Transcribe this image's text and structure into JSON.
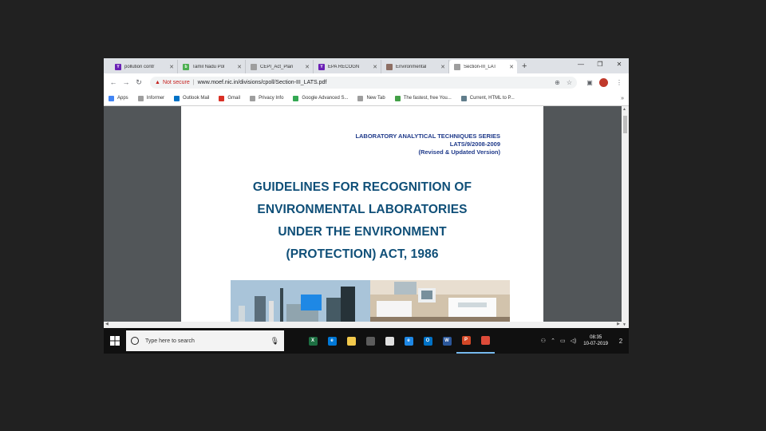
{
  "browser": {
    "tabs": [
      {
        "title": "pollution contr",
        "fav_letter": "Y",
        "fav_color": "#6a1fb5"
      },
      {
        "title": "Tamil Nadu Pol",
        "fav_letter": "b",
        "fav_color": "#4caf50"
      },
      {
        "title": "CEPI_Act_Plan",
        "fav_letter": "",
        "fav_color": "#9e9e9e"
      },
      {
        "title": "EPA RECOGN",
        "fav_letter": "Y",
        "fav_color": "#6a1fb5"
      },
      {
        "title": "Environmental",
        "fav_letter": "",
        "fav_color": "#8d6e63"
      },
      {
        "title": "Section-III_LAT",
        "fav_letter": "",
        "fav_color": "#9e9e9e"
      }
    ],
    "active_tab": 5,
    "security_label": "Not secure",
    "url": "www.moef.nic.in/divisions/cpoll/Section-III_LATS.pdf",
    "bookmarks": [
      {
        "label": "Apps",
        "color": "#4285f4"
      },
      {
        "label": "Informer",
        "color": "#9e9e9e"
      },
      {
        "label": "Outlook Mail",
        "color": "#0072c6"
      },
      {
        "label": "Gmail",
        "color": "#d93025"
      },
      {
        "label": "Privacy Info",
        "color": "#9e9e9e"
      },
      {
        "label": "Google Advanced S...",
        "color": "#34a853"
      },
      {
        "label": "New Tab",
        "color": "#9e9e9e"
      },
      {
        "label": "The fastest, free You...",
        "color": "#43a047"
      },
      {
        "label": "Current, HTML to P...",
        "color": "#607d8b"
      }
    ],
    "bookmarks_more": "»"
  },
  "document": {
    "series": [
      "LABORATORY ANALYTICAL TECHNIQUES SERIES",
      "LATS/9/2008-2009",
      "(Revised & Updated Version)"
    ],
    "title_lines": [
      "GUIDELINES FOR RECOGNITION OF",
      "ENVIRONMENTAL LABORATORIES",
      "UNDER THE ENVIRONMENT",
      "(PROTECTION) ACT, 1986"
    ]
  },
  "taskbar": {
    "search_placeholder": "Type here to search",
    "apps": [
      {
        "name": "task-view",
        "letter": "",
        "color": "#101010"
      },
      {
        "name": "excel",
        "letter": "X",
        "color": "#1d6f42"
      },
      {
        "name": "edge",
        "letter": "e",
        "color": "#0078d7"
      },
      {
        "name": "file-explorer",
        "letter": "",
        "color": "#f2c94c"
      },
      {
        "name": "store",
        "letter": "",
        "color": "#5c5c5c"
      },
      {
        "name": "mail",
        "letter": "",
        "color": "#e0e0e0"
      },
      {
        "name": "internet-explorer",
        "letter": "e",
        "color": "#1e88e5"
      },
      {
        "name": "outlook",
        "letter": "O",
        "color": "#0072c6"
      },
      {
        "name": "word",
        "letter": "W",
        "color": "#2b579a"
      },
      {
        "name": "powerpoint",
        "letter": "P",
        "color": "#d24726"
      },
      {
        "name": "chrome",
        "letter": "",
        "color": "#dd4b39"
      }
    ],
    "time": "08:35",
    "date": "10-07-2019",
    "notification_count": "2"
  }
}
